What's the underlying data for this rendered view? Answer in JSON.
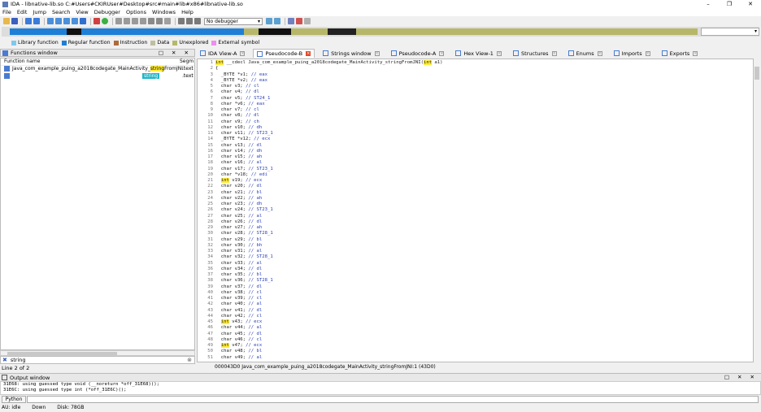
{
  "window": {
    "title": "IDA - libnative-lib.so C:#Users#CKIRUser#Desktop#src#main#lib#x86#libnative-lib.so",
    "min": "–",
    "max": "❐",
    "close": "✕"
  },
  "menu": [
    "File",
    "Edit",
    "Jump",
    "Search",
    "View",
    "Debugger",
    "Options",
    "Windows",
    "Help"
  ],
  "toolbar": {
    "debugger": "No debugger"
  },
  "legend": [
    {
      "label": "Library function",
      "color": "#7ec8f0"
    },
    {
      "label": "Regular function",
      "color": "#1f7fd6"
    },
    {
      "label": "Instruction",
      "color": "#b06a3a"
    },
    {
      "label": "Data",
      "color": "#bfbf9f"
    },
    {
      "label": "Unexplored",
      "color": "#b7b76a"
    },
    {
      "label": "External symbol",
      "color": "#f08cf0"
    }
  ],
  "functions_window": {
    "title": "Functions window",
    "col_name": "Function name",
    "col_seg": "Segm",
    "rows": [
      {
        "pre": "Java_com_example_puing_a2018codegate_MainActivity_",
        "hl": "string",
        "post": "FromJNI",
        "seg": ".text"
      },
      {
        "pre": "",
        "hl": "",
        "post": "string",
        "seg": ".text"
      }
    ],
    "search": "string",
    "line_status": "Line 2 of 2"
  },
  "tabs": [
    {
      "label": "IDA View-A",
      "active": false
    },
    {
      "label": "Pseudocode-B",
      "active": true
    },
    {
      "label": "Strings window",
      "active": false
    },
    {
      "label": "Pseudocode-A",
      "active": false
    },
    {
      "label": "Hex View-1",
      "active": false
    },
    {
      "label": "Structures",
      "active": false
    },
    {
      "label": "Enums",
      "active": false
    },
    {
      "label": "Imports",
      "active": false
    },
    {
      "label": "Exports",
      "active": false
    }
  ],
  "code_header": {
    "kw": "int",
    "rest": " __cdecl Java_com_example_puing_a2018codegate_MainActivity_stringFromJNI(",
    "kw2": "int",
    "rest2": " a1)"
  },
  "code_lines": [
    {
      "t": "{",
      "c": ""
    },
    {
      "t": "  _BYTE *v1;",
      "c": "// eax"
    },
    {
      "t": "  _BYTE *v2;",
      "c": "// eax"
    },
    {
      "t": "  char v3;",
      "c": "// cl"
    },
    {
      "t": "  char v4;",
      "c": "// dl"
    },
    {
      "t": "  char v5;",
      "c": "// ST24_1"
    },
    {
      "t": "  char *v6;",
      "c": "// eax"
    },
    {
      "t": "  char v7;",
      "c": "// cl"
    },
    {
      "t": "  char v8;",
      "c": "// dl"
    },
    {
      "t": "  char v9;",
      "c": "// ch"
    },
    {
      "t": "  char v10;",
      "c": "// dh"
    },
    {
      "t": "  char v11;",
      "c": "// ST23_1"
    },
    {
      "t": "  _BYTE *v12;",
      "c": "// ecx"
    },
    {
      "t": "  char v13;",
      "c": "// dl"
    },
    {
      "t": "  char v14;",
      "c": "// dh"
    },
    {
      "t": "  char v15;",
      "c": "// ah"
    },
    {
      "t": "  char v16;",
      "c": "// al"
    },
    {
      "t": "  char v17;",
      "c": "// ST23_1"
    },
    {
      "t": "  char *v18;",
      "c": "// edi"
    },
    {
      "t": "  int v19;",
      "c": "// ecx",
      "kw": true
    },
    {
      "t": "  char v20;",
      "c": "// dl"
    },
    {
      "t": "  char v21;",
      "c": "// bl"
    },
    {
      "t": "  char v22;",
      "c": "// ah"
    },
    {
      "t": "  char v23;",
      "c": "// dh"
    },
    {
      "t": "  char v24;",
      "c": "// ST23_1"
    },
    {
      "t": "  char v25;",
      "c": "// al"
    },
    {
      "t": "  char v26;",
      "c": "// dl"
    },
    {
      "t": "  char v27;",
      "c": "// ah"
    },
    {
      "t": "  char v28;",
      "c": "// ST28_1"
    },
    {
      "t": "  char v29;",
      "c": "// bl"
    },
    {
      "t": "  char v30;",
      "c": "// bh"
    },
    {
      "t": "  char v31;",
      "c": "// al"
    },
    {
      "t": "  char v32;",
      "c": "// ST28_1"
    },
    {
      "t": "  char v33;",
      "c": "// al"
    },
    {
      "t": "  char v34;",
      "c": "// dl"
    },
    {
      "t": "  char v35;",
      "c": "// bl"
    },
    {
      "t": "  char v36;",
      "c": "// ST28_1"
    },
    {
      "t": "  char v37;",
      "c": "// dl"
    },
    {
      "t": "  char v38;",
      "c": "// cl"
    },
    {
      "t": "  char v39;",
      "c": "// cl"
    },
    {
      "t": "  char v40;",
      "c": "// al"
    },
    {
      "t": "  char v41;",
      "c": "// dl"
    },
    {
      "t": "  char v42;",
      "c": "// cl"
    },
    {
      "t": "  int v43;",
      "c": "// ecx",
      "kw": true
    },
    {
      "t": "  char v44;",
      "c": "// al"
    },
    {
      "t": "  char v45;",
      "c": "// dl"
    },
    {
      "t": "  char v46;",
      "c": "// cl"
    },
    {
      "t": "  int v47;",
      "c": "// ecx",
      "kw": true
    },
    {
      "t": "  char v48;",
      "c": "// bl"
    },
    {
      "t": "  char v49;",
      "c": "// al"
    }
  ],
  "code_status": "000043D0 Java_com_example_puing_a2018codegate_MainActivity_stringFromJNI:1 (43D0)",
  "output": {
    "title": "Output window",
    "lines": [
      "31E68: using guessed type void (__noreturn *off_31E68)();",
      "31E6C: using guessed type int (*off_31E6C)();"
    ]
  },
  "python_label": "Python",
  "status": {
    "au": "AU:  idle",
    "dir": "Down",
    "disk": "Disk: 78GB"
  }
}
